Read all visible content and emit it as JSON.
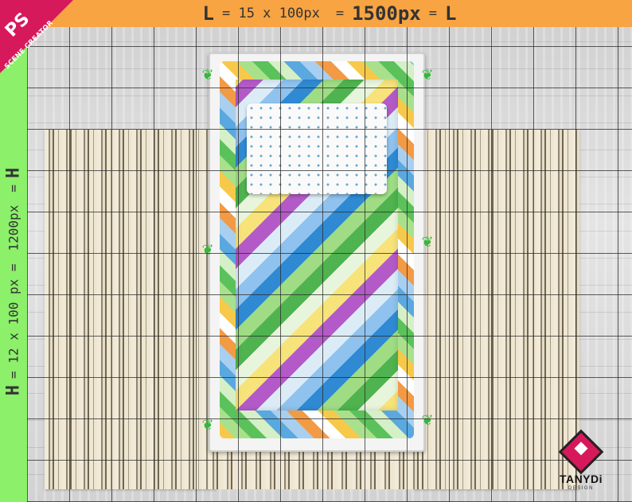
{
  "badge": {
    "main": "PS",
    "sub": "SCENE CREATOR"
  },
  "top_ruler": {
    "left_letter": "L",
    "formula": "= 15 x 100px",
    "eq": "=",
    "result": "1500px",
    "eq2": "=",
    "right_letter": "L"
  },
  "left_ruler": {
    "left_letter": "H",
    "formula": "= 12 x 100 px =",
    "result": "1200px",
    "eq": "=",
    "right_letter": "H"
  },
  "logo": {
    "brand": "TANYDi",
    "tagline": "DESIGN"
  },
  "colors": {
    "top_ruler": "#f8a443",
    "left_ruler": "#8cf06a",
    "badge": "#d6195b"
  }
}
